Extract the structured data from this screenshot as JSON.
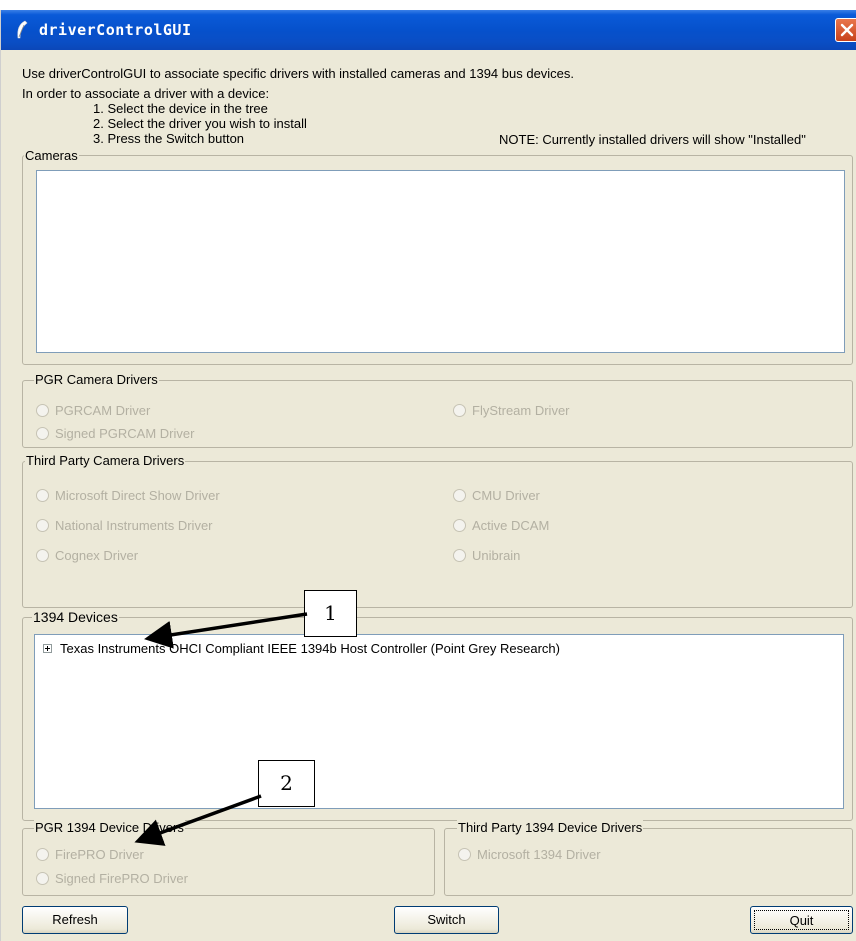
{
  "window": {
    "title": "driverControlGUI"
  },
  "intro": {
    "line1": "Use driverControlGUI to associate specific drivers with installed cameras and 1394 bus devices.",
    "line2": "In order to associate a driver with a device:",
    "step1": "1. Select the device in the tree",
    "step2": "2. Select the driver you wish to install",
    "step3": "3. Press the Switch button",
    "note": "NOTE: Currently installed drivers will show \"Installed\""
  },
  "cameras": {
    "legend": "Cameras"
  },
  "pgr_camera_drivers": {
    "legend": "PGR Camera Drivers",
    "options": [
      "PGRCAM Driver",
      "Signed PGRCAM Driver",
      "FlyStream Driver"
    ]
  },
  "third_party_camera_drivers": {
    "legend": "Third Party Camera Drivers",
    "options": [
      "Microsoft Direct Show Driver",
      "National Instruments Driver",
      "Cognex Driver",
      "CMU Driver",
      "Active DCAM",
      "Unibrain"
    ]
  },
  "devices_1394": {
    "legend": "1394 Devices",
    "items": [
      "Texas Instruments OHCI Compliant IEEE 1394b Host Controller (Point Grey Research)"
    ]
  },
  "pgr_1394_drivers": {
    "legend": "PGR 1394 Device Drivers",
    "options": [
      "FirePRO Driver",
      "Signed FirePRO  Driver"
    ]
  },
  "third_party_1394_drivers": {
    "legend": "Third Party 1394 Device Drivers",
    "options": [
      "Microsoft 1394 Driver"
    ]
  },
  "buttons": {
    "refresh": "Refresh",
    "switch": "Switch",
    "quit": "Quit"
  },
  "callouts": {
    "one": "1",
    "two": "2"
  },
  "icons": {
    "app_icon": "feather-icon",
    "close_icon": "close-x-icon",
    "expander_icon": "plus-expander-icon"
  },
  "colors": {
    "titlebar": "#0651cc",
    "window_bg": "#ece9d8",
    "close_button": "#d8572e",
    "disabled_text": "#b3b0a2"
  }
}
